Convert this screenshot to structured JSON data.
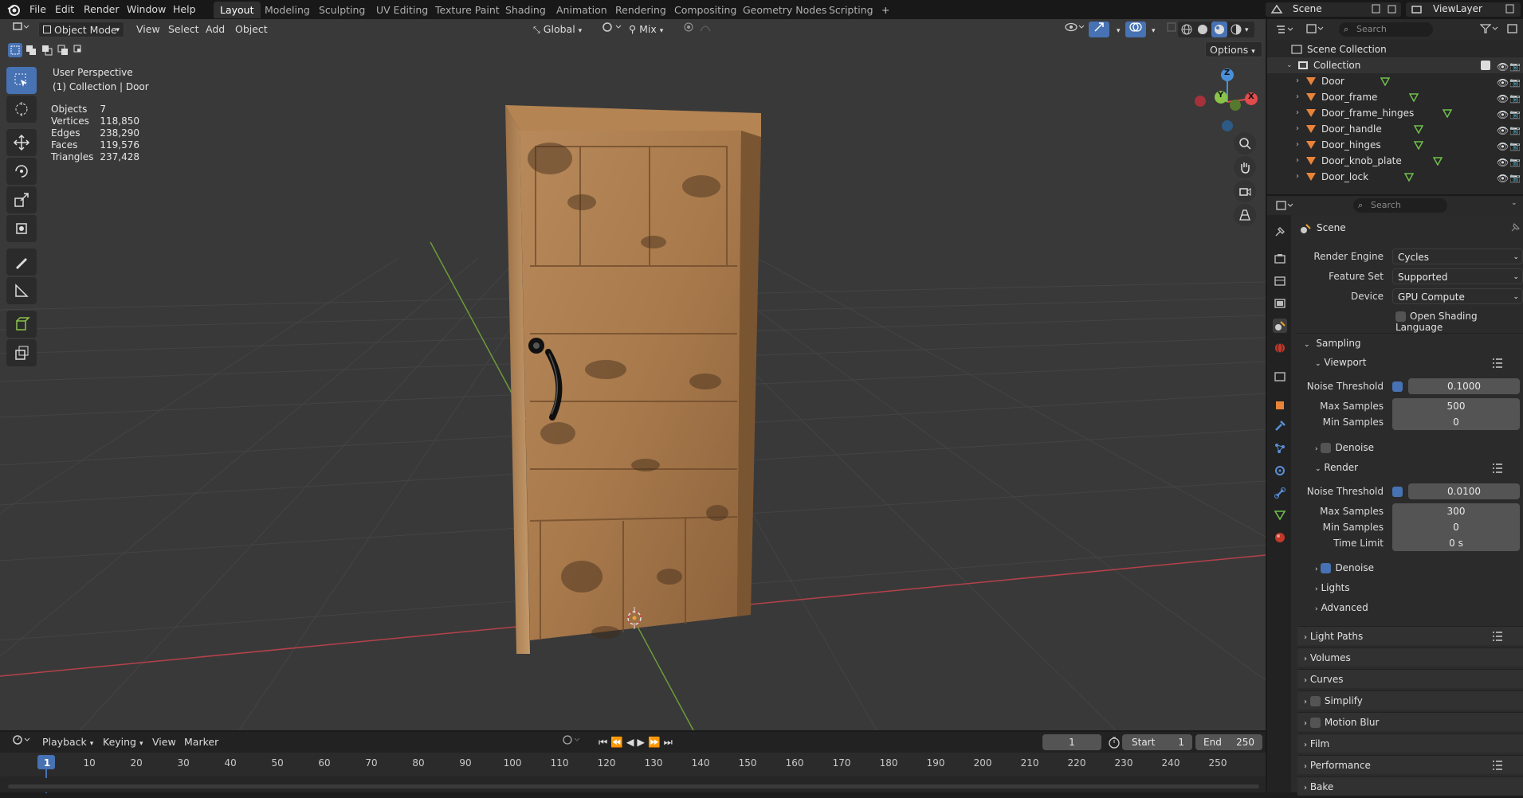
{
  "topbar": {
    "menus": [
      "File",
      "Edit",
      "Render",
      "Window",
      "Help"
    ],
    "workspaces": [
      "Layout",
      "Modeling",
      "Sculpting",
      "UV Editing",
      "Texture Paint",
      "Shading",
      "Animation",
      "Rendering",
      "Compositing",
      "Geometry Nodes",
      "Scripting"
    ],
    "active_workspace": "Layout",
    "add_tab": "+",
    "scene": "Scene",
    "view_layer": "ViewLayer"
  },
  "viewport_header": {
    "mode": "Object Mode",
    "menus": [
      "View",
      "Select",
      "Add",
      "Object"
    ],
    "orientation": "Global",
    "snap_mix": "Mix",
    "options": "Options"
  },
  "overlay": {
    "perspective": "User Perspective",
    "collection": "(1) Collection | Door",
    "stats": [
      {
        "label": "Objects",
        "value": "7"
      },
      {
        "label": "Vertices",
        "value": "118,850"
      },
      {
        "label": "Edges",
        "value": "238,290"
      },
      {
        "label": "Faces",
        "value": "119,576"
      },
      {
        "label": "Triangles",
        "value": "237,428"
      }
    ]
  },
  "gizmo": {
    "x": "X",
    "y": "Y",
    "z": "Z"
  },
  "timeline": {
    "menus": [
      "Playback",
      "Keying",
      "View",
      "Marker"
    ],
    "current_frame": "1",
    "start_label": "Start",
    "start": "1",
    "end_label": "End",
    "end": "250",
    "ticks": [
      "1",
      "10",
      "20",
      "30",
      "40",
      "50",
      "60",
      "70",
      "80",
      "90",
      "100",
      "110",
      "120",
      "130",
      "140",
      "150",
      "160",
      "170",
      "180",
      "190",
      "200",
      "210",
      "220",
      "230",
      "240",
      "250"
    ]
  },
  "outliner": {
    "search_placeholder": "Search",
    "root": "Scene Collection",
    "collection": "Collection",
    "objects": [
      "Door",
      "Door_frame",
      "Door_frame_hinges",
      "Door_handle",
      "Door_hinges",
      "Door_knob_plate",
      "Door_lock"
    ]
  },
  "properties": {
    "search_placeholder": "Search",
    "context": "Scene",
    "render_engine_label": "Render Engine",
    "render_engine": "Cycles",
    "feature_set_label": "Feature Set",
    "feature_set": "Supported",
    "device_label": "Device",
    "device": "GPU Compute",
    "osl_label": "Open Shading Language",
    "sampling": "Sampling",
    "viewport": "Viewport",
    "vp_noise_label": "Noise Threshold",
    "vp_noise": "0.1000",
    "vp_max_label": "Max Samples",
    "vp_max": "500",
    "vp_min_label": "Min Samples",
    "vp_min": "0",
    "vp_denoise": "Denoise",
    "render": "Render",
    "r_noise_label": "Noise Threshold",
    "r_noise": "0.0100",
    "r_max_label": "Max Samples",
    "r_max": "300",
    "r_min_label": "Min Samples",
    "r_min": "0",
    "r_time_label": "Time Limit",
    "r_time": "0 s",
    "r_denoise": "Denoise",
    "lights": "Lights",
    "advanced": "Advanced",
    "sections": [
      "Light Paths",
      "Volumes",
      "Curves",
      "Simplify",
      "Motion Blur",
      "Film",
      "Performance",
      "Bake"
    ]
  },
  "colors": {
    "accent": "#4772b3",
    "axis_x": "#e14b4b",
    "axis_y": "#8bc34a",
    "axis_z": "#4a90d9",
    "object_icon": "#e8833a"
  }
}
